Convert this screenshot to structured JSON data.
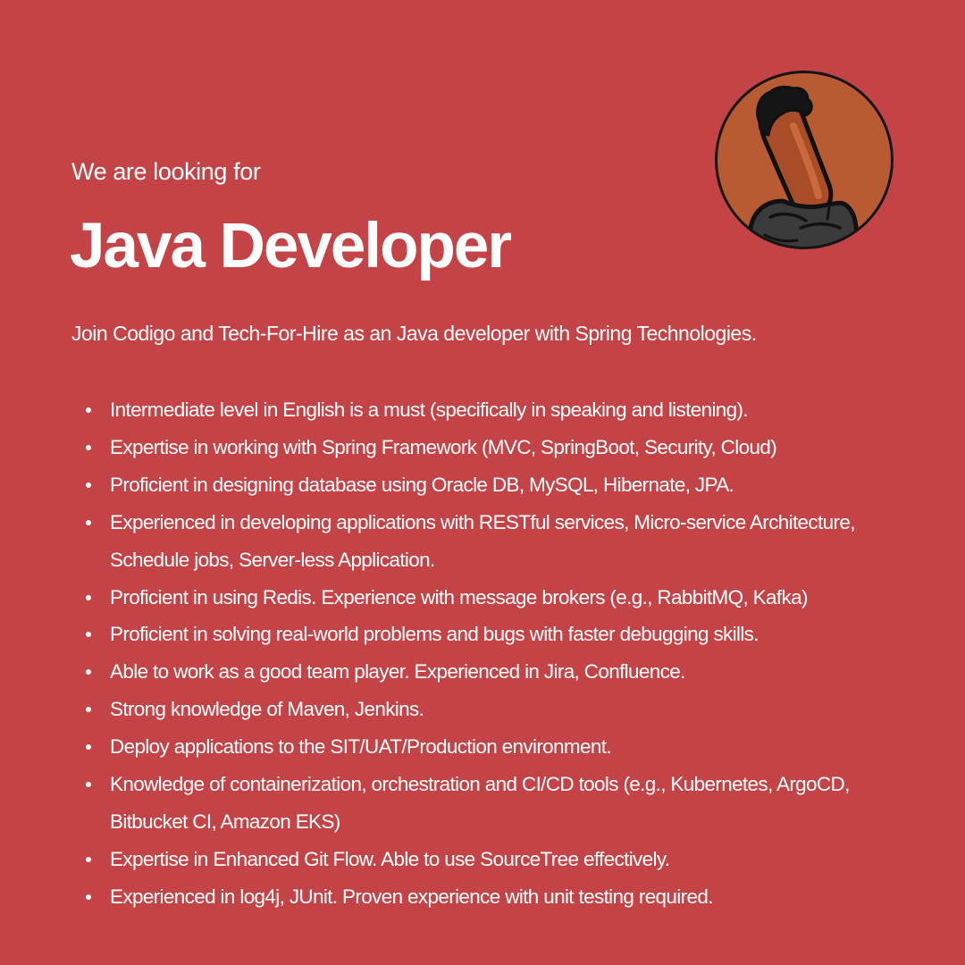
{
  "header": {
    "eyebrow": "We are looking for",
    "title": "Java Developer"
  },
  "intro": "Join Codigo and Tech-For-Hire as an Java developer with Spring Technologies.",
  "requirements": [
    "Intermediate level in English is a must (specifically in speaking and listening).",
    "Expertise in working with Spring Framework (MVC, SpringBoot, Security, Cloud)",
    "Proficient in designing database using Oracle DB, MySQL, Hibernate, JPA.",
    "Experienced in developing applications with RESTful services, Micro-service Architecture, Schedule jobs, Server-less Application.",
    "Proficient in using Redis. Experience with message brokers (e.g., RabbitMQ, Kafka)",
    "Proficient in solving real-world problems and bugs with faster debugging skills.",
    "Able to work as a good team player. Experienced in Jira, Confluence.",
    "Strong knowledge of Maven, Jenkins.",
    "Deploy applications to the SIT/UAT/Production environment.",
    "Knowledge of containerization, orchestration and CI/CD tools (e.g., Kubernetes, ArgoCD, Bitbucket CI, Amazon EKS)",
    "Expertise in Enhanced Git Flow. Able to use SourceTree effectively.",
    "Experienced in log4j, JUnit. Proven experience with unit testing required."
  ],
  "colors": {
    "background": "#c44347",
    "text": "#ffffff",
    "avatar_fill": "#b85a32"
  },
  "icons": {
    "avatar": "long-head-character-icon"
  }
}
